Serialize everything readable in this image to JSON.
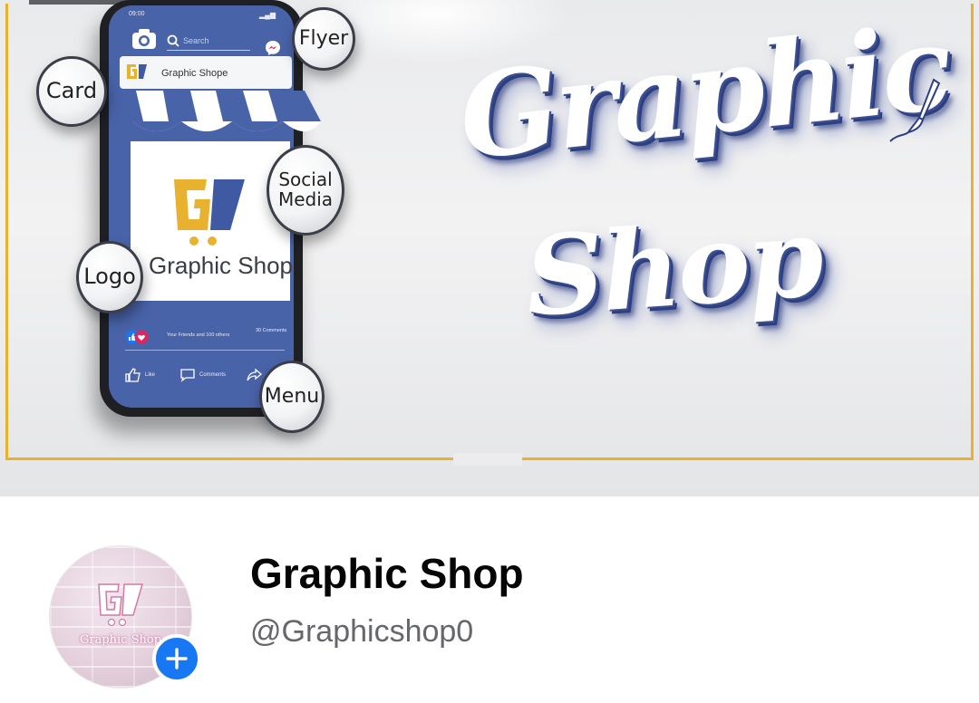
{
  "cover": {
    "phone": {
      "status_time": "09:00",
      "search_placeholder": "Search",
      "page_name": "Graphic Shope",
      "card_name": "Graphic Shop",
      "reactions_text": "Your Friends and 100 others",
      "comments_count": "30 Comments",
      "like_label": "Like",
      "comments_label": "Comments"
    },
    "bubbles": {
      "card": "Card",
      "flyer": "Flyer",
      "social_line1": "Social",
      "social_line2": "Media",
      "logo": "Logo",
      "menu": "Menu"
    },
    "script_title_line1": "Graphic",
    "script_title_line2": "Shop",
    "colors": {
      "frame": "#e8b22e",
      "phone_blue": "#4963a8",
      "script_shadow": "#2d3f80"
    }
  },
  "profile": {
    "avatar_text": "Graphic Shop",
    "name": "Graphic Shop",
    "handle": "@Graphicshop0",
    "add_icon": "plus-icon",
    "accent": "#1877f2"
  }
}
